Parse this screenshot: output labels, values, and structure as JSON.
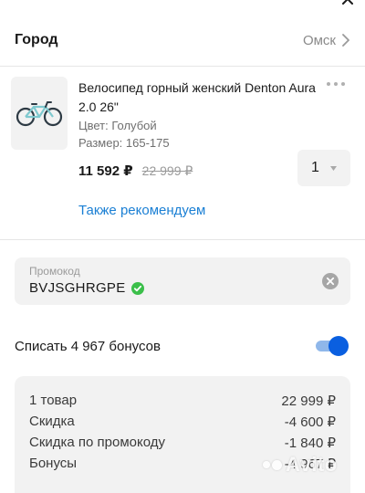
{
  "city": {
    "label": "Город",
    "value": "Омск"
  },
  "product": {
    "title": "Велосипед горный женский Denton Aura 2.0 26\"",
    "color": "Цвет: Голубой",
    "size": "Размер: 165-175",
    "price": "11 592 ₽",
    "old_price": "22 999 ₽",
    "quantity": "1"
  },
  "recommend_link": "Также рекомендуем",
  "promo": {
    "label": "Промокод",
    "code": "BVJSGHRGPE"
  },
  "bonus": {
    "label": "Списать 4 967 бонусов",
    "enabled": true
  },
  "summary": {
    "rows": [
      {
        "label": "1 товар",
        "value": "22 999 ₽"
      },
      {
        "label": "Скидка",
        "value": "-4 600 ₽"
      },
      {
        "label": "Скидка по промокоду",
        "value": "-1 840 ₽"
      },
      {
        "label": "Бонусы",
        "value": "-4 967 ₽"
      }
    ]
  },
  "watermark": "Avito",
  "colors": {
    "accent": "#1a7fd4",
    "toggle": "#0a5fe0",
    "success": "#3bbf4a"
  },
  "icons": [
    "close-icon",
    "chevron-right-icon",
    "more-icon",
    "bicycle-icon",
    "caret-down-icon",
    "check-icon",
    "clear-icon"
  ]
}
